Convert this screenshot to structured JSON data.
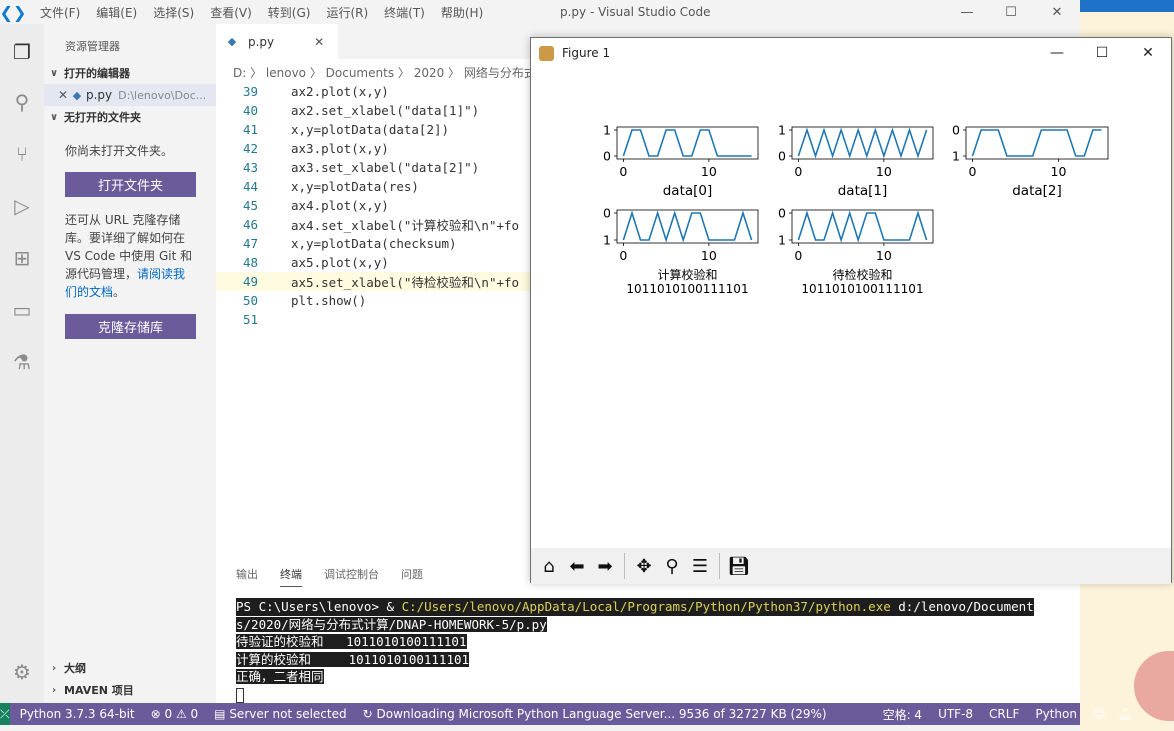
{
  "window": {
    "title": "p.py - Visual Studio Code",
    "minimize": "—",
    "maximize": "☐",
    "close": "✕"
  },
  "menu": [
    "文件(F)",
    "编辑(E)",
    "选择(S)",
    "查看(V)",
    "转到(G)",
    "运行(R)",
    "终端(T)",
    "帮助(H)"
  ],
  "sidebar": {
    "title": "资源管理器",
    "open_editors": "打开的编辑器",
    "open_file_name": "p.py",
    "open_file_path": "D:\\lenovo\\Doc...",
    "no_folder": "无打开的文件夹",
    "no_folder_msg": "你尚未打开文件夹。",
    "open_folder_btn": "打开文件夹",
    "clone_text_1": "还可从 URL 克隆存储",
    "clone_text_2": "库。要详细了解如何在",
    "clone_text_3": "VS Code 中使用 Git 和",
    "clone_text_4": "源代码管理，",
    "clone_link_1": "请阅读我",
    "clone_link_2": "们的文档",
    "clone_end": "。",
    "clone_btn": "克隆存储库",
    "outline": "大纲",
    "maven": "MAVEN 项目"
  },
  "editor": {
    "tab_label": "p.py",
    "breadcrumb": "D: 〉 lenovo 〉 Documents 〉 2020 〉 网络与分布式计",
    "lines": [
      {
        "n": "39",
        "t": "ax2.plot(x,y)"
      },
      {
        "n": "40",
        "t": "ax2.set_xlabel(\"data[1]\")"
      },
      {
        "n": "41",
        "t": "x,y=plotData(data[2])"
      },
      {
        "n": "42",
        "t": "ax3.plot(x,y)"
      },
      {
        "n": "43",
        "t": "ax3.set_xlabel(\"data[2]\")"
      },
      {
        "n": "44",
        "t": "x,y=plotData(res)"
      },
      {
        "n": "45",
        "t": "ax4.plot(x,y)"
      },
      {
        "n": "46",
        "t": "ax4.set_xlabel(\"计算校验和\\n\"+fo"
      },
      {
        "n": "47",
        "t": "x,y=plotData(checksum)"
      },
      {
        "n": "48",
        "t": "ax5.plot(x,y)"
      },
      {
        "n": "49",
        "t": "ax5.set_xlabel(\"待检校验和\\n\"+fo"
      },
      {
        "n": "50",
        "t": "plt.show()"
      },
      {
        "n": "51",
        "t": ""
      }
    ]
  },
  "panel": {
    "tabs": [
      "输出",
      "终端",
      "调试控制台",
      "问题"
    ],
    "term_prompt": "PS C:\\Users\\lenovo> & ",
    "term_exe": "C:/Users/lenovo/AppData/Local/Programs/Python/Python37/python.exe",
    "term_arg": " d:/lenovo/Document",
    "term_line2": "s/2020/网络与分布式计算/DNAP-HOMEWORK-5/p.py",
    "term_line3": "待验证的校验和   1011010100111101",
    "term_line4": "计算的校验和     1011010100111101",
    "term_line5": "正确，二者相同"
  },
  "status": {
    "python": "Python 3.7.3 64-bit",
    "problems": "⊗ 0 ⚠ 0",
    "server": "Server not selected",
    "download": "Downloading Microsoft Python Language Server... 9536 of 32727 KB (29%)",
    "spaces": "空格: 4",
    "encoding": "UTF-8",
    "eol": "CRLF",
    "lang": "Python"
  },
  "figure": {
    "title": "Figure 1",
    "minimize": "—",
    "maximize": "☐",
    "close": "✕"
  },
  "chart_data": [
    {
      "type": "line",
      "xlabel": "data[0]",
      "ylabel": "",
      "yticks": [
        "1",
        "0"
      ],
      "xticks": [
        "0",
        "10"
      ],
      "x": [
        0,
        1,
        2,
        3,
        4,
        5,
        6,
        7,
        8,
        9,
        10,
        11,
        12,
        13,
        14,
        15
      ],
      "y": [
        0,
        1,
        1,
        0,
        0,
        1,
        1,
        0,
        0,
        1,
        1,
        0,
        0,
        0,
        0,
        0
      ]
    },
    {
      "type": "line",
      "xlabel": "data[1]",
      "ylabel": "",
      "yticks": [
        "1",
        "0"
      ],
      "xticks": [
        "0",
        "10"
      ],
      "x": [
        0,
        1,
        2,
        3,
        4,
        5,
        6,
        7,
        8,
        9,
        10,
        11,
        12,
        13,
        14,
        15
      ],
      "y": [
        0,
        1,
        0,
        1,
        0,
        1,
        0,
        1,
        0,
        1,
        0,
        1,
        0,
        1,
        0,
        1
      ]
    },
    {
      "type": "line",
      "xlabel": "data[2]",
      "ylabel": "",
      "yticks": [
        "0",
        "1"
      ],
      "xticks": [
        "0",
        "10"
      ],
      "x": [
        0,
        1,
        2,
        3,
        4,
        5,
        6,
        7,
        8,
        9,
        10,
        11,
        12,
        13,
        14,
        15
      ],
      "y": [
        1,
        0,
        0,
        0,
        1,
        1,
        1,
        1,
        0,
        0,
        0,
        0,
        1,
        1,
        0,
        0
      ]
    },
    {
      "type": "line",
      "xlabel": "计算校验和",
      "xlabel2": "1011010100111101",
      "ylabel": "",
      "yticks": [
        "0",
        "1"
      ],
      "xticks": [
        "0",
        "10"
      ],
      "x": [
        0,
        1,
        2,
        3,
        4,
        5,
        6,
        7,
        8,
        9,
        10,
        11,
        12,
        13,
        14,
        15
      ],
      "y": [
        1,
        0,
        1,
        1,
        0,
        1,
        0,
        1,
        0,
        0,
        1,
        1,
        1,
        1,
        0,
        1
      ]
    },
    {
      "type": "line",
      "xlabel": "待检校验和",
      "xlabel2": "1011010100111101",
      "ylabel": "",
      "yticks": [
        "0",
        "1"
      ],
      "xticks": [
        "0",
        "10"
      ],
      "x": [
        0,
        1,
        2,
        3,
        4,
        5,
        6,
        7,
        8,
        9,
        10,
        11,
        12,
        13,
        14,
        15
      ],
      "y": [
        1,
        0,
        1,
        1,
        0,
        1,
        0,
        1,
        0,
        0,
        1,
        1,
        1,
        1,
        0,
        1
      ]
    }
  ]
}
